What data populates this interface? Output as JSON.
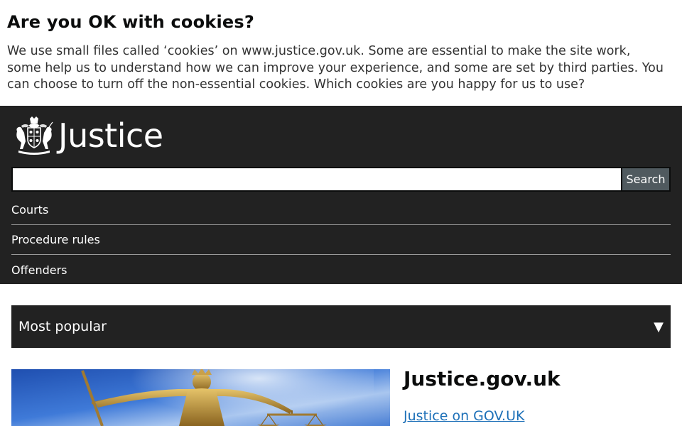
{
  "cookie_banner": {
    "title": "Are you OK with cookies?",
    "text": "We use small files called ‘cookies’ on www.justice.gov.uk. Some are essential to make the site work, some help us to understand how we can improve your experience, and some are set by third parties. You can choose to turn off the non-essential cookies. Which cookies are you happy for us to use?"
  },
  "header": {
    "logo_text": "Justice",
    "logo_icon": "royal-coat-of-arms-icon",
    "search": {
      "value": "",
      "placeholder": "",
      "button_label": "Search"
    },
    "nav": {
      "items": [
        {
          "label": "Courts"
        },
        {
          "label": "Procedure rules"
        },
        {
          "label": "Offenders"
        }
      ]
    }
  },
  "most_popular": {
    "label": "Most popular",
    "icon": "triangle-down-icon"
  },
  "hero": {
    "title": "Justice.gov.uk",
    "link_label": "Justice on GOV.UK",
    "image_subject": "lady-justice-statue"
  },
  "colors": {
    "header_bg": "#222222",
    "link": "#1d70b8",
    "search_button": "#505a5f"
  }
}
